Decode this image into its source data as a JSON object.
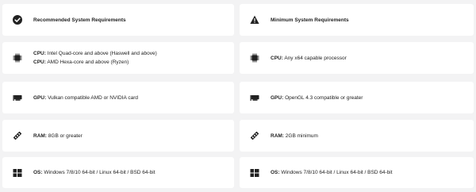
{
  "recommended": {
    "title": "Recommended System Requirements",
    "icon": "check-circle-icon",
    "cpu": {
      "label": "CPU:",
      "lines": [
        "Intel Quad-core and above (Haswell and above)",
        "AMD Hexa-core and above (Ryzen)"
      ]
    },
    "gpu": {
      "label": "GPU:",
      "value": "Vulkan compatible AMD or NVIDIA card"
    },
    "ram": {
      "label": "RAM:",
      "value": "8GB or greater"
    },
    "os": {
      "label": "OS:",
      "value": "Windows 7/8/10 64-bit / Linux 64-bit / BSD 64-bit"
    }
  },
  "minimum": {
    "title": "Minimum System Requirements",
    "icon": "warning-triangle-icon",
    "cpu": {
      "label": "CPU:",
      "value": "Any x64 capable processor"
    },
    "gpu": {
      "label": "GPU:",
      "value": "OpenGL 4.3 compatible or greater"
    },
    "ram": {
      "label": "RAM:",
      "value": "2GB minimum"
    },
    "os": {
      "label": "OS:",
      "value": "Windows 7/8/10 64-bit / Linux 64-bit / BSD 64-bit"
    }
  }
}
